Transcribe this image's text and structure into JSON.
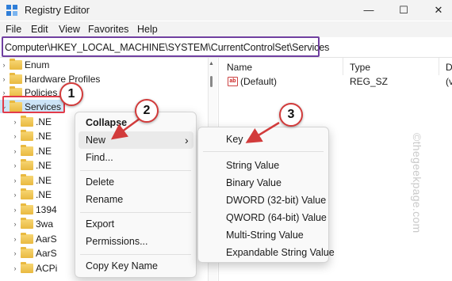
{
  "window": {
    "title": "Registry Editor",
    "controls": {
      "minimize": "—",
      "maximize": "☐",
      "close": "✕"
    }
  },
  "menu": [
    "File",
    "Edit",
    "View",
    "Favorites",
    "Help"
  ],
  "address": "Computer\\HKEY_LOCAL_MACHINE\\SYSTEM\\CurrentControlSet\\Services",
  "tree": {
    "top_items": [
      "Enum",
      "Hardware Profiles",
      "Policies",
      "Services"
    ],
    "children": [
      ".NE",
      ".NE",
      ".NE",
      ".NE",
      ".NE",
      ".NE",
      "1394",
      "3wa",
      "AarS",
      "AarS",
      "ACPi"
    ]
  },
  "list": {
    "headers": {
      "name": "Name",
      "type": "Type",
      "data": "D"
    },
    "rows": [
      {
        "name": "(Default)",
        "type": "REG_SZ",
        "data": "(v"
      }
    ],
    "icon_text": "ab"
  },
  "context_menu": {
    "items": {
      "collapse": "Collapse",
      "new": "New",
      "find": "Find...",
      "delete": "Delete",
      "rename": "Rename",
      "export": "Export",
      "permissions": "Permissions...",
      "copy_key_name": "Copy Key Name"
    },
    "submenu_arrow": "›"
  },
  "submenu": {
    "items": [
      "Key",
      "String Value",
      "Binary Value",
      "DWORD (32-bit) Value",
      "QWORD (64-bit) Value",
      "Multi-String Value",
      "Expandable String Value"
    ]
  },
  "callouts": [
    "1",
    "2",
    "3"
  ],
  "watermark": "©thegeekpage.com",
  "colors": {
    "annotation_red": "#d23b3b",
    "address_highlight": "#7040a0",
    "selection": "#cce4f7"
  }
}
